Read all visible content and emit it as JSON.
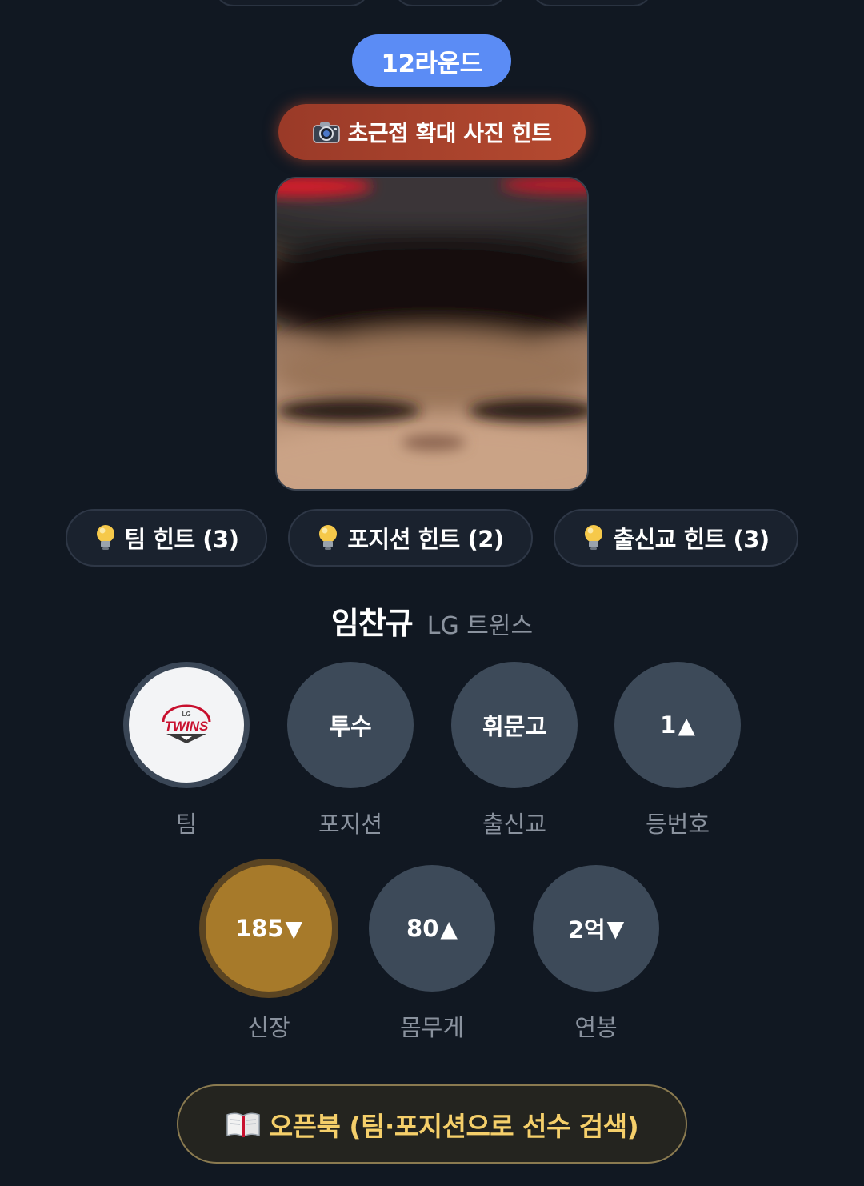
{
  "round": {
    "label": "12라운드"
  },
  "photo_hint": {
    "label": "초근접 확대 사진 힌트",
    "icon": "camera-icon"
  },
  "hints": [
    {
      "label": "팀 힌트 (3)",
      "icon": "lightbulb-icon"
    },
    {
      "label": "포지션 힌트 (2)",
      "icon": "lightbulb-icon"
    },
    {
      "label": "출신교 힌트 (3)",
      "icon": "lightbulb-icon"
    }
  ],
  "answer": {
    "name": "임찬규",
    "team": "LG 트윈스"
  },
  "team_logo": {
    "line1": "LG",
    "line2": "TWINS"
  },
  "stats": {
    "team": {
      "label": "팀"
    },
    "position": {
      "value": "투수",
      "label": "포지션"
    },
    "school": {
      "value": "휘문고",
      "label": "출신교"
    },
    "number": {
      "value": "1",
      "arrow": "▲",
      "label": "등번호"
    },
    "height": {
      "value": "185",
      "arrow": "▼",
      "label": "신장"
    },
    "weight": {
      "value": "80",
      "arrow": "▲",
      "label": "몸무게"
    },
    "salary": {
      "value": "2억",
      "arrow": "▼",
      "label": "연봉"
    }
  },
  "openbook": {
    "label": "오픈북 (팀·포지션으로 선수 검색)",
    "icon": "open-book-icon"
  },
  "colors": {
    "background": "#111822",
    "round_badge": "#5b8cf5",
    "photo_hint": "#b54a30",
    "stat_circle": "#3d4a59",
    "highlight": "#a77a2a",
    "openbook_text": "#f5cf6a"
  }
}
